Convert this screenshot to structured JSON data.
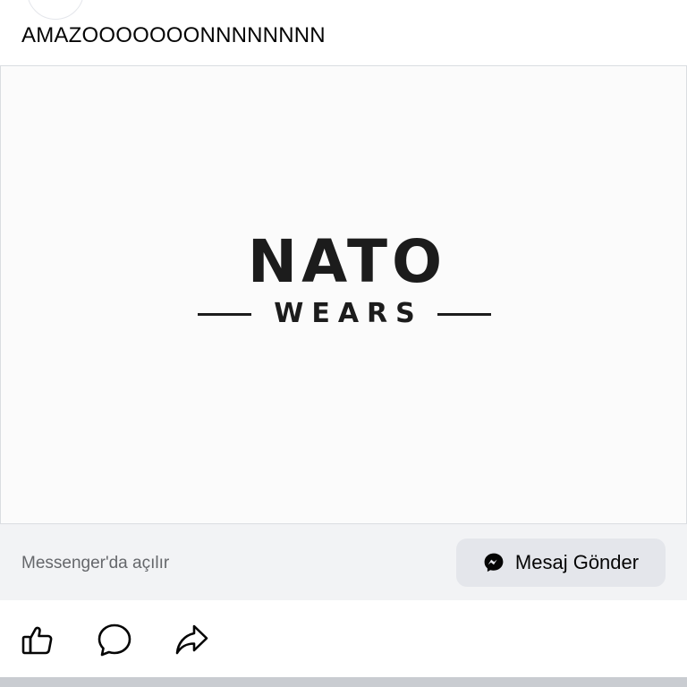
{
  "post": {
    "text": "AMAZOOOOOOONNNNNNNN"
  },
  "ad": {
    "brand_logo": {
      "title": "NATO",
      "subtitle": "WEARS"
    },
    "cta_bar": {
      "caption": "Messenger'da açılır",
      "button_label": "Mesaj Gönder",
      "button_icon": "messenger-icon"
    }
  },
  "actions": [
    {
      "icon": "thumbs-up-icon"
    },
    {
      "icon": "comment-icon"
    },
    {
      "icon": "share-arrow-icon"
    }
  ],
  "colors": {
    "text_primary": "#050505",
    "text_secondary": "#65676b",
    "cta_bar_bg": "#f2f3f5",
    "cta_button_bg": "#e4e6eb",
    "divider": "#c9ccd1"
  }
}
